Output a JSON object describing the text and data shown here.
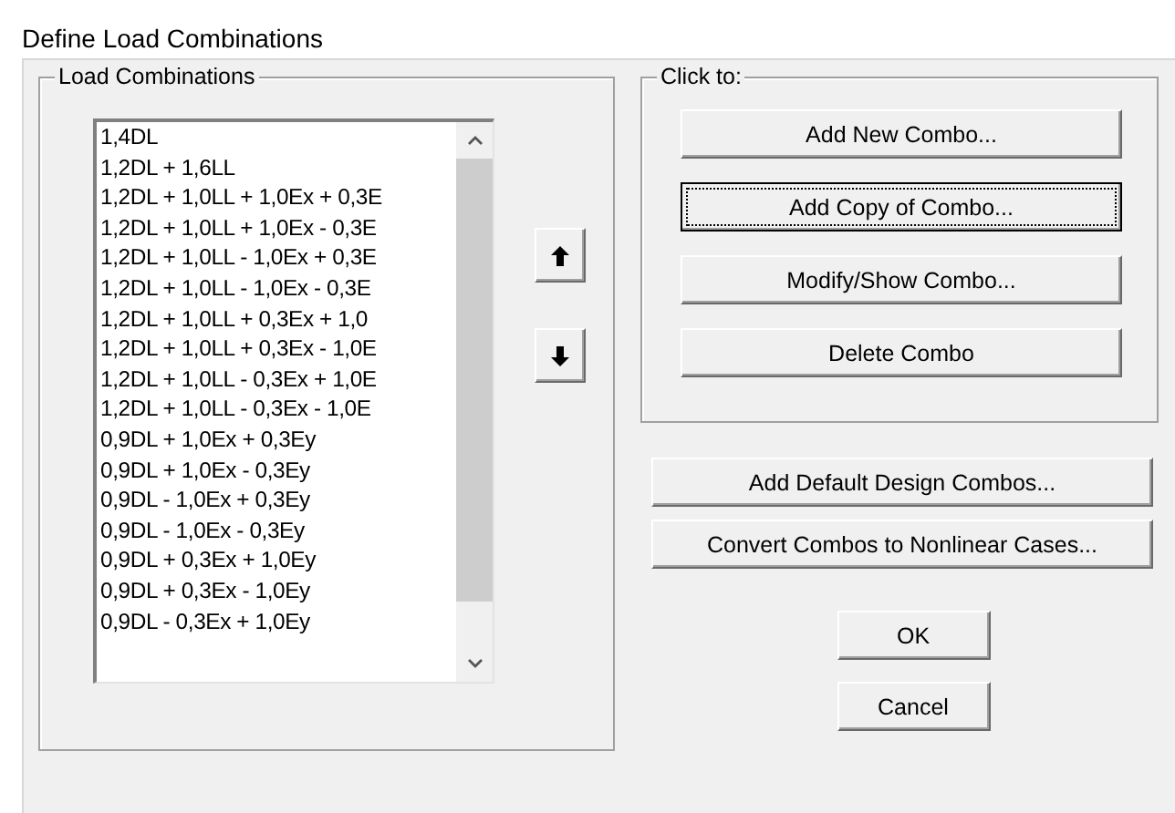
{
  "window": {
    "title": "Define Load Combinations"
  },
  "combinations": {
    "title": "Load Combinations",
    "items": [
      "1,4DL",
      "1,2DL + 1,6LL",
      "1,2DL + 1,0LL + 1,0Ex + 0,3E",
      "1,2DL + 1,0LL + 1,0Ex - 0,3E",
      "1,2DL + 1,0LL - 1,0Ex + 0,3E",
      "1,2DL + 1,0LL - 1,0Ex - 0,3E",
      "1,2DL + 1,0LL + 0,3Ex + 1,0",
      "1,2DL + 1,0LL + 0,3Ex - 1,0E",
      "1,2DL + 1,0LL - 0,3Ex + 1,0E",
      "1,2DL + 1,0LL - 0,3Ex - 1,0E",
      "0,9DL + 1,0Ex + 0,3Ey",
      "0,9DL + 1,0Ex - 0,3Ey",
      "0,9DL - 1,0Ex + 0,3Ey",
      "0,9DL - 1,0Ex - 0,3Ey",
      "0,9DL + 0,3Ex + 1,0Ey",
      "0,9DL + 0,3Ex - 1,0Ey",
      "0,9DL - 0,3Ex + 1,0Ey"
    ]
  },
  "click_to": {
    "title": "Click to:",
    "buttons": [
      {
        "label": "Add New Combo...",
        "focused": false
      },
      {
        "label": "Add Copy of Combo...",
        "focused": true
      },
      {
        "label": "Modify/Show Combo...",
        "focused": false
      },
      {
        "label": "Delete Combo",
        "focused": false
      }
    ]
  },
  "extra_buttons": [
    "Add Default Design Combos...",
    "Convert Combos to Nonlinear Cases..."
  ],
  "dialog_buttons": [
    "OK",
    "Cancel"
  ]
}
